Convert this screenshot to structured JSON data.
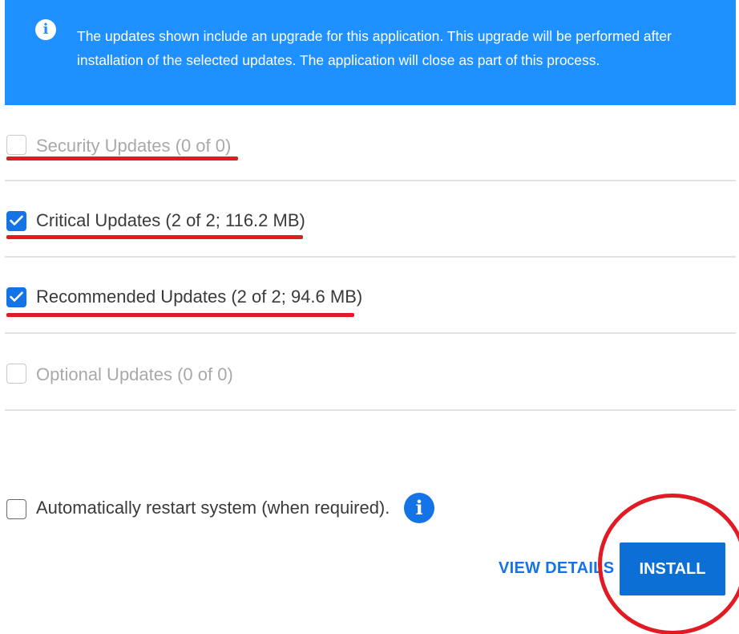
{
  "banner": {
    "icon": "info-icon",
    "message": "The updates shown include an upgrade for this application. This upgrade will be performed after installation of the selected updates. The application will close as part of this process."
  },
  "categories": [
    {
      "label": "Security Updates (0 of 0)",
      "checked": false,
      "disabled": true
    },
    {
      "label": "Critical Updates (2 of 2; 116.2 MB)",
      "checked": true,
      "disabled": false
    },
    {
      "label": "Recommended Updates (2 of 2; 94.6 MB)",
      "checked": true,
      "disabled": false
    },
    {
      "label": "Optional Updates (0 of 0)",
      "checked": false,
      "disabled": true
    }
  ],
  "restart": {
    "label": "Automatically restart system (when required).",
    "checked": false,
    "info_icon": "info-icon"
  },
  "actions": {
    "view_details": "VIEW DETAILS",
    "install": "INSTALL"
  },
  "colors": {
    "banner": "#1e90ff",
    "accent": "#1473e6",
    "annotation": "#e01b24"
  }
}
